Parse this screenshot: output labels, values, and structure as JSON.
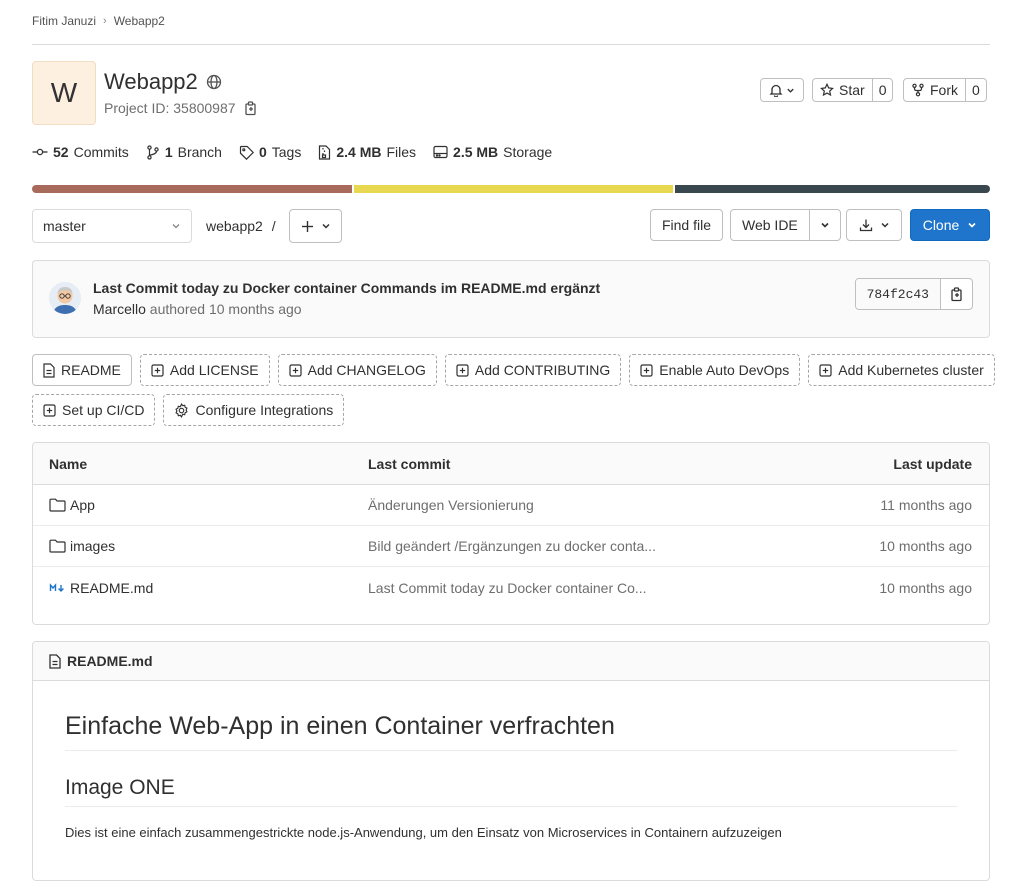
{
  "breadcrumb": {
    "owner": "Fitim Januzi",
    "separator": "›",
    "project": "Webapp2"
  },
  "project": {
    "avatar_letter": "W",
    "name": "Webapp2",
    "id_text": "Project ID: 35800987"
  },
  "actions": {
    "star_label": "Star",
    "star_count": "0",
    "fork_label": "Fork",
    "fork_count": "0"
  },
  "stats": {
    "commits_count": "52",
    "commits_label": "Commits",
    "branch_count": "1",
    "branch_label": "Branch",
    "tags_count": "0",
    "tags_label": "Tags",
    "files_size": "2.4 MB",
    "files_label": "Files",
    "storage_size": "2.5 MB",
    "storage_label": "Storage"
  },
  "language_bar": [
    {
      "color": "#a86a5b",
      "share": 0.335
    },
    {
      "color": "#e8d84f",
      "share": 0.335
    },
    {
      "color": "#39484e",
      "share": 0.33
    }
  ],
  "controls": {
    "branch": "master",
    "path": "webapp2",
    "path_sep": "/",
    "find_file": "Find file",
    "web_ide": "Web IDE",
    "clone": "Clone"
  },
  "last_commit": {
    "title": "Last Commit today zu Docker container Commands im README.md ergänzt",
    "author": "Marcello",
    "authored": "authored",
    "time": "10 months ago",
    "sha": "784f2c43"
  },
  "quick_actions": [
    {
      "label": "README",
      "icon": "file-icon",
      "style": "solid"
    },
    {
      "label": "Add LICENSE",
      "icon": "plus-square-icon",
      "style": "dashed"
    },
    {
      "label": "Add CHANGELOG",
      "icon": "plus-square-icon",
      "style": "dashed"
    },
    {
      "label": "Add CONTRIBUTING",
      "icon": "plus-square-icon",
      "style": "dashed"
    },
    {
      "label": "Enable Auto DevOps",
      "icon": "plus-square-icon",
      "style": "dashed"
    },
    {
      "label": "Add Kubernetes cluster",
      "icon": "plus-square-icon",
      "style": "dashed"
    },
    {
      "label": "Set up CI/CD",
      "icon": "plus-square-icon",
      "style": "dashed"
    },
    {
      "label": "Configure Integrations",
      "icon": "settings-icon",
      "style": "dashed"
    }
  ],
  "file_table": {
    "headers": {
      "name": "Name",
      "last_commit": "Last commit",
      "last_update": "Last update"
    },
    "rows": [
      {
        "name": "App",
        "icon": "folder-icon",
        "commit": "Änderungen Versionierung",
        "updated": "11 months ago"
      },
      {
        "name": "images",
        "icon": "folder-icon",
        "commit": "Bild geändert /Ergänzungen zu docker conta...",
        "updated": "10 months ago"
      },
      {
        "name": "README.md",
        "icon": "markdown-icon",
        "commit": "Last Commit today zu Docker container Co...",
        "updated": "10 months ago"
      }
    ]
  },
  "readme": {
    "filename": "README.md",
    "h1": "Einfache Web-App in einen Container verfrachten",
    "h2": "Image ONE",
    "paragraph": "Dies ist eine einfach zusammengestrickte node.js-Anwendung, um den Einsatz von Microservices in Containern aufzuzeigen"
  }
}
